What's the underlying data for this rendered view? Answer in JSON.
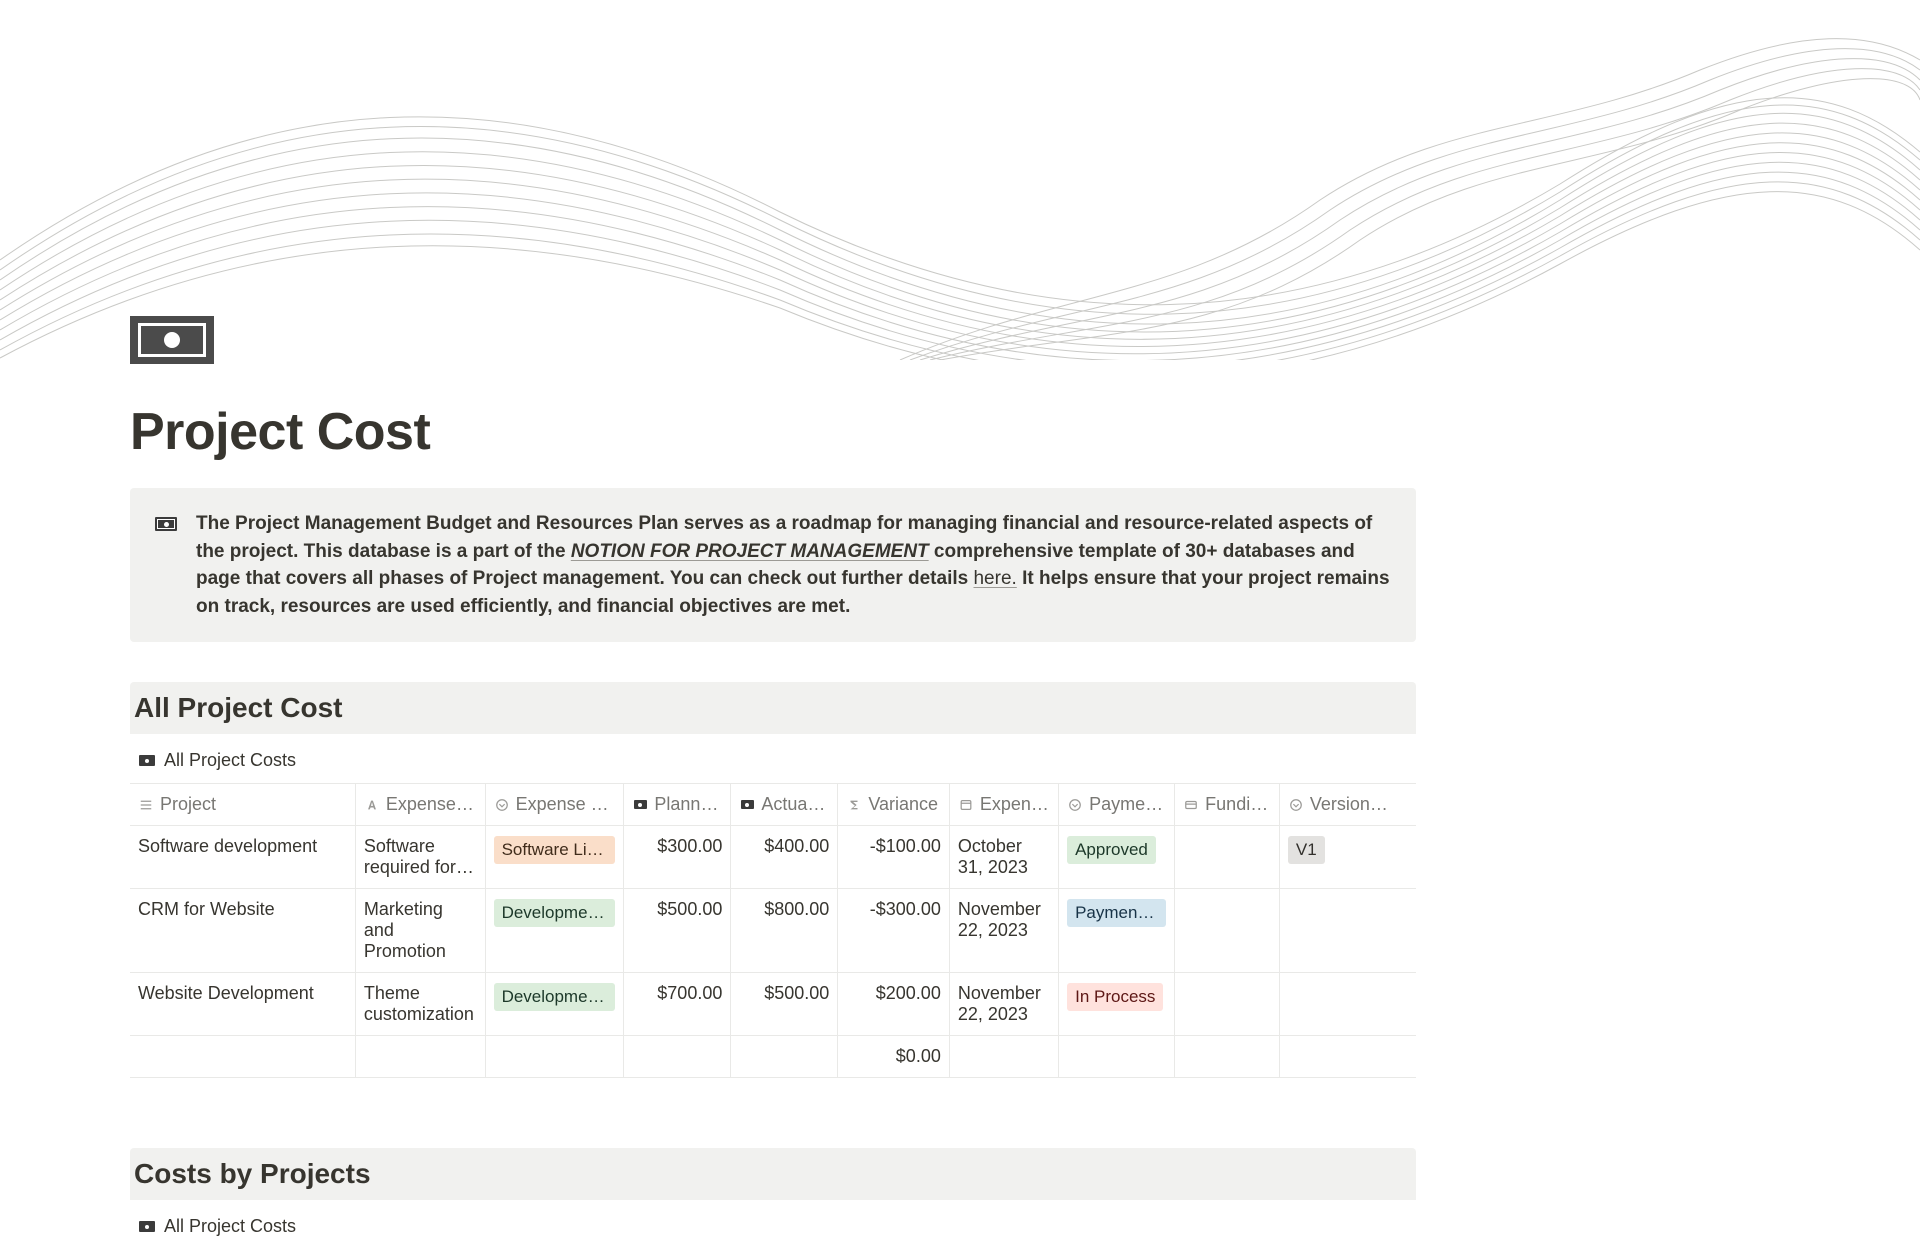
{
  "page": {
    "title": "Project Cost"
  },
  "callout": {
    "pre": "The Project Management Budget and Resources Plan serves as a roadmap for managing financial and resource-related aspects of the project. This  database is a part of the ",
    "link1": "NOTION FOR PROJECT MANAGEMENT",
    "mid": " comprehensive template of 30+ databases and page that covers all phases of Project management. You can check out further details ",
    "link2": "here.",
    "post": " It helps ensure that your project remains on track, resources are used efficiently, and financial objectives are met."
  },
  "sections": {
    "all_cost_heading": "All Project Cost",
    "costs_by_projects_heading": "Costs by Projects"
  },
  "views": {
    "all_project_costs": "All Project Costs",
    "all_project_costs_2": "All Project Costs"
  },
  "columns": {
    "project": "Project",
    "expense_desc": "Expense …",
    "expense_cat": "Expense Ca…",
    "planned": "Planne…",
    "actual": "Actual …",
    "variance": "Variance",
    "expense_date": "Expens…",
    "payment": "Payme…",
    "funding": "Fundin…",
    "version": "Version…"
  },
  "rows": [
    {
      "project": "Software development",
      "desc": "Software required for…",
      "category": "Software Lic…",
      "category_color": "orange",
      "planned": "$300.00",
      "actual": "$400.00",
      "variance": "-$100.00",
      "date": "October 31, 2023",
      "payment": "Approved",
      "payment_color": "green",
      "version": "V1"
    },
    {
      "project": "CRM for Website",
      "desc": "Marketing and Promotion",
      "category": "Development…",
      "category_color": "green",
      "planned": "$500.00",
      "actual": "$800.00",
      "variance": "-$300.00",
      "date": "November 22, 2023",
      "payment": "Payment…",
      "payment_color": "blue",
      "version": ""
    },
    {
      "project": "Website Development",
      "desc": "Theme customization",
      "category": "Development…",
      "category_color": "green",
      "planned": "$700.00",
      "actual": "$500.00",
      "variance": "$200.00",
      "date": "November 22, 2023",
      "payment": "In Process",
      "payment_color": "red",
      "version": ""
    }
  ],
  "footer": {
    "variance_total": "$0.00"
  }
}
